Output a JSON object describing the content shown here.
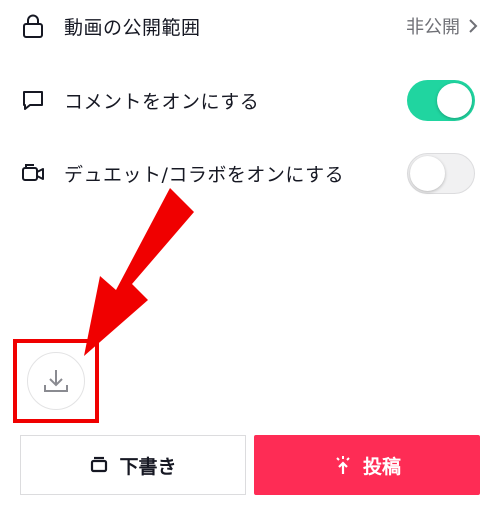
{
  "settings": {
    "privacy": {
      "label": "動画の公開範囲",
      "value": "非公開",
      "icon": "lock-icon"
    },
    "comments": {
      "label": "コメントをオンにする",
      "enabled": true,
      "icon": "comment-icon"
    },
    "duet": {
      "label": "デュエット/コラボをオンにする",
      "enabled": false,
      "icon": "duet-icon"
    }
  },
  "actions": {
    "download_icon": "download-icon",
    "draft_label": "下書き",
    "post_label": "投稿"
  },
  "colors": {
    "toggle_on": "#20d5a0",
    "post_button": "#fe2c55",
    "annotation": "#f00000"
  }
}
